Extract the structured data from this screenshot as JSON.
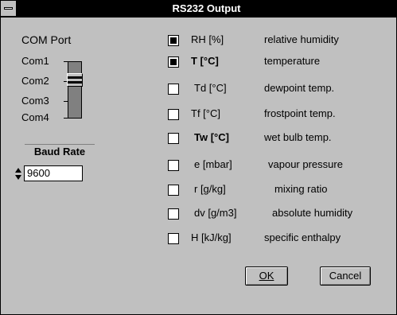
{
  "window": {
    "title": "RS232 Output"
  },
  "com_port": {
    "label": "COM Port",
    "ports": [
      "Com1",
      "Com2",
      "Com3",
      "Com4"
    ],
    "selected": "Com2"
  },
  "baud_rate": {
    "label": "Baud Rate",
    "value": "9600"
  },
  "outputs": [
    {
      "symbol": "RH [%]",
      "description": "relative humidity",
      "checked": true
    },
    {
      "symbol": "T [°C]",
      "description": "temperature",
      "checked": true
    },
    {
      "symbol": "Td [°C]",
      "description": "dewpoint temp.",
      "checked": false
    },
    {
      "symbol": "Tf [°C]",
      "description": "frostpoint temp.",
      "checked": false
    },
    {
      "symbol": "Tw [°C]",
      "description": "wet bulb temp.",
      "checked": false
    },
    {
      "symbol": "e [mbar]",
      "description": "vapour pressure",
      "checked": false
    },
    {
      "symbol": "r [g/kg]",
      "description": "mixing ratio",
      "checked": false
    },
    {
      "symbol": "dv [g/m3]",
      "description": "absolute humidity",
      "checked": false
    },
    {
      "symbol": "H [kJ/kg]",
      "description": "specific enthalpy",
      "checked": false
    }
  ],
  "buttons": {
    "ok": "OK",
    "cancel": "Cancel"
  }
}
